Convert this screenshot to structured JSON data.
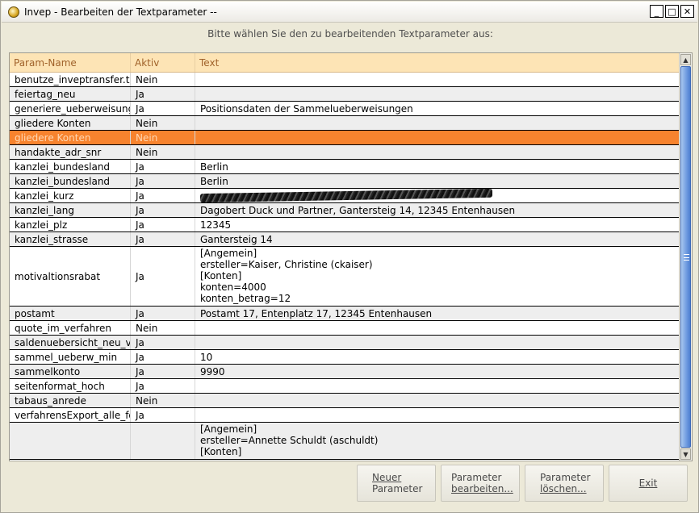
{
  "window": {
    "title": "Invep - Bearbeiten der Textparameter --",
    "minimize_glyph": "_",
    "maximize_glyph": "□",
    "close_glyph": "✕"
  },
  "prompt": "Bitte wählen Sie den zu bearbeitenden Textparameter aus:",
  "table": {
    "headers": [
      "Param-Name",
      "Aktiv",
      "Text"
    ],
    "rows": [
      {
        "name": "benutze_inveptransfer.txt",
        "aktiv": "Nein",
        "text": ""
      },
      {
        "name": "feiertag_neu",
        "aktiv": "Ja",
        "text": ""
      },
      {
        "name": "generiere_ueberweisung_",
        "aktiv": "Ja",
        "text": "Positionsdaten der Sammelueberweisungen"
      },
      {
        "name": "gliedere Konten",
        "aktiv": "Nein",
        "text": ""
      },
      {
        "name": "gliedere Konten",
        "aktiv": "Nein",
        "text": "",
        "selected": true
      },
      {
        "name": "handakte_adr_snr",
        "aktiv": "Nein",
        "text": ""
      },
      {
        "name": "kanzlei_bundesland",
        "aktiv": "Ja",
        "text": "Berlin"
      },
      {
        "name": "kanzlei_bundesland",
        "aktiv": "Ja",
        "text": "Berlin"
      },
      {
        "name": "kanzlei_kurz",
        "aktiv": "Ja",
        "text": "",
        "scrubbed": true
      },
      {
        "name": "kanzlei_lang",
        "aktiv": "Ja",
        "text": "Dagobert Duck und Partner, Gantersteig 14, 12345 Entenhausen"
      },
      {
        "name": "kanzlei_plz",
        "aktiv": "Ja",
        "text": "12345"
      },
      {
        "name": "kanzlei_strasse",
        "aktiv": "Ja",
        "text": "Gantersteig 14"
      },
      {
        "name": "motivaltionsrabat",
        "aktiv": "Ja",
        "text": "[Angemein]\nersteller=Kaiser, Christine (ckaiser)\n[Konten]\nkonten=4000\nkonten_betrag=12",
        "lines": 5
      },
      {
        "name": "postamt",
        "aktiv": "Ja",
        "text": "Postamt 17, Entenplatz 17, 12345 Entenhausen"
      },
      {
        "name": "quote_im_verfahren",
        "aktiv": "Nein",
        "text": ""
      },
      {
        "name": "saldenuebersicht_neu_vc",
        "aktiv": "Ja",
        "text": ""
      },
      {
        "name": "sammel_ueberw_min",
        "aktiv": "Ja",
        "text": "10"
      },
      {
        "name": "sammelkonto",
        "aktiv": "Ja",
        "text": "9990"
      },
      {
        "name": "seitenformat_hoch",
        "aktiv": "Ja",
        "text": ""
      },
      {
        "name": "tabaus_anrede",
        "aktiv": "Nein",
        "text": ""
      },
      {
        "name": "verfahrensExport_alle_for",
        "aktiv": "Ja",
        "text": ""
      },
      {
        "name": "",
        "aktiv": "",
        "text": "[Angemein]\nersteller=Annette Schuldt (aschuldt)\n[Konten]",
        "lines": 3
      }
    ]
  },
  "scrollbar": {
    "up_glyph": "▲",
    "down_glyph": "▼"
  },
  "buttons": {
    "new": {
      "line1": "Neuer",
      "line2": "Parameter"
    },
    "edit": {
      "line1": "Parameter",
      "line2": "bearbeiten..."
    },
    "delete": {
      "line1": "Parameter",
      "line2": "löschen..."
    },
    "exit": "Exit"
  }
}
